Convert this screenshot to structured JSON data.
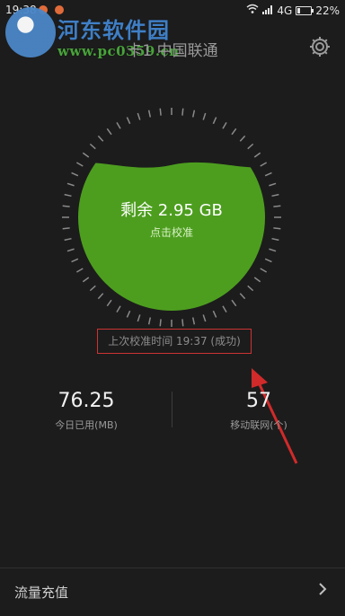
{
  "status_bar": {
    "time": "19:38",
    "network": "4G",
    "battery_percent": "22%",
    "notification_colors": [
      "#e06b3a",
      "#e06b3a"
    ]
  },
  "watermark": {
    "title": "河东软件园",
    "url": "www.pc0359.cn",
    "title_color": "#3f7fc6",
    "url_color": "#48a33a"
  },
  "header": {
    "title": "卡1 中国联通",
    "settings_icon": "gear-icon"
  },
  "gauge": {
    "remaining": "剩余 2.95 GB",
    "calibrate": "点击校准",
    "fill_color": "#4d9e1f",
    "fill_fraction": 0.78
  },
  "last_calibration": "上次校准时间 19:37 (成功)",
  "stats": {
    "today_used": {
      "value": "76.25",
      "label": "今日已用(MB)"
    },
    "mobile_network": {
      "value": "57",
      "label": "移动联网(个)"
    }
  },
  "bottom": {
    "recharge_label": "流量充值",
    "recharge_icon": "arrow-icon"
  },
  "colors": {
    "background": "#1c1c1c",
    "highlight_border": "#cc3333",
    "arrow": "#d12a2a"
  }
}
